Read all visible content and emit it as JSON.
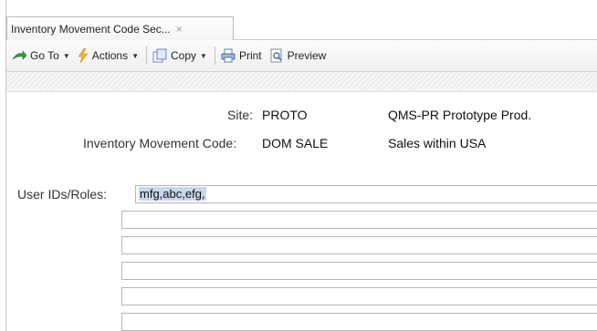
{
  "tab": {
    "title": "Inventory Movement Code Sec...",
    "close_glyph": "×"
  },
  "toolbar": {
    "goto_label": "Go To",
    "actions_label": "Actions",
    "copy_label": "Copy",
    "print_label": "Print",
    "preview_label": "Preview"
  },
  "form": {
    "site_label": "Site:",
    "site_value": "PROTO",
    "site_desc": "QMS-PR Prototype Prod.",
    "imc_label": "Inventory Movement Code:",
    "imc_value": "DOM SALE",
    "imc_desc": "Sales within USA",
    "users_label": "User IDs/Roles:",
    "users_first_value": "mfg,abc,efg,"
  },
  "colors": {
    "selection": "#c7d7ee",
    "field_border": "#b5b5b5"
  }
}
